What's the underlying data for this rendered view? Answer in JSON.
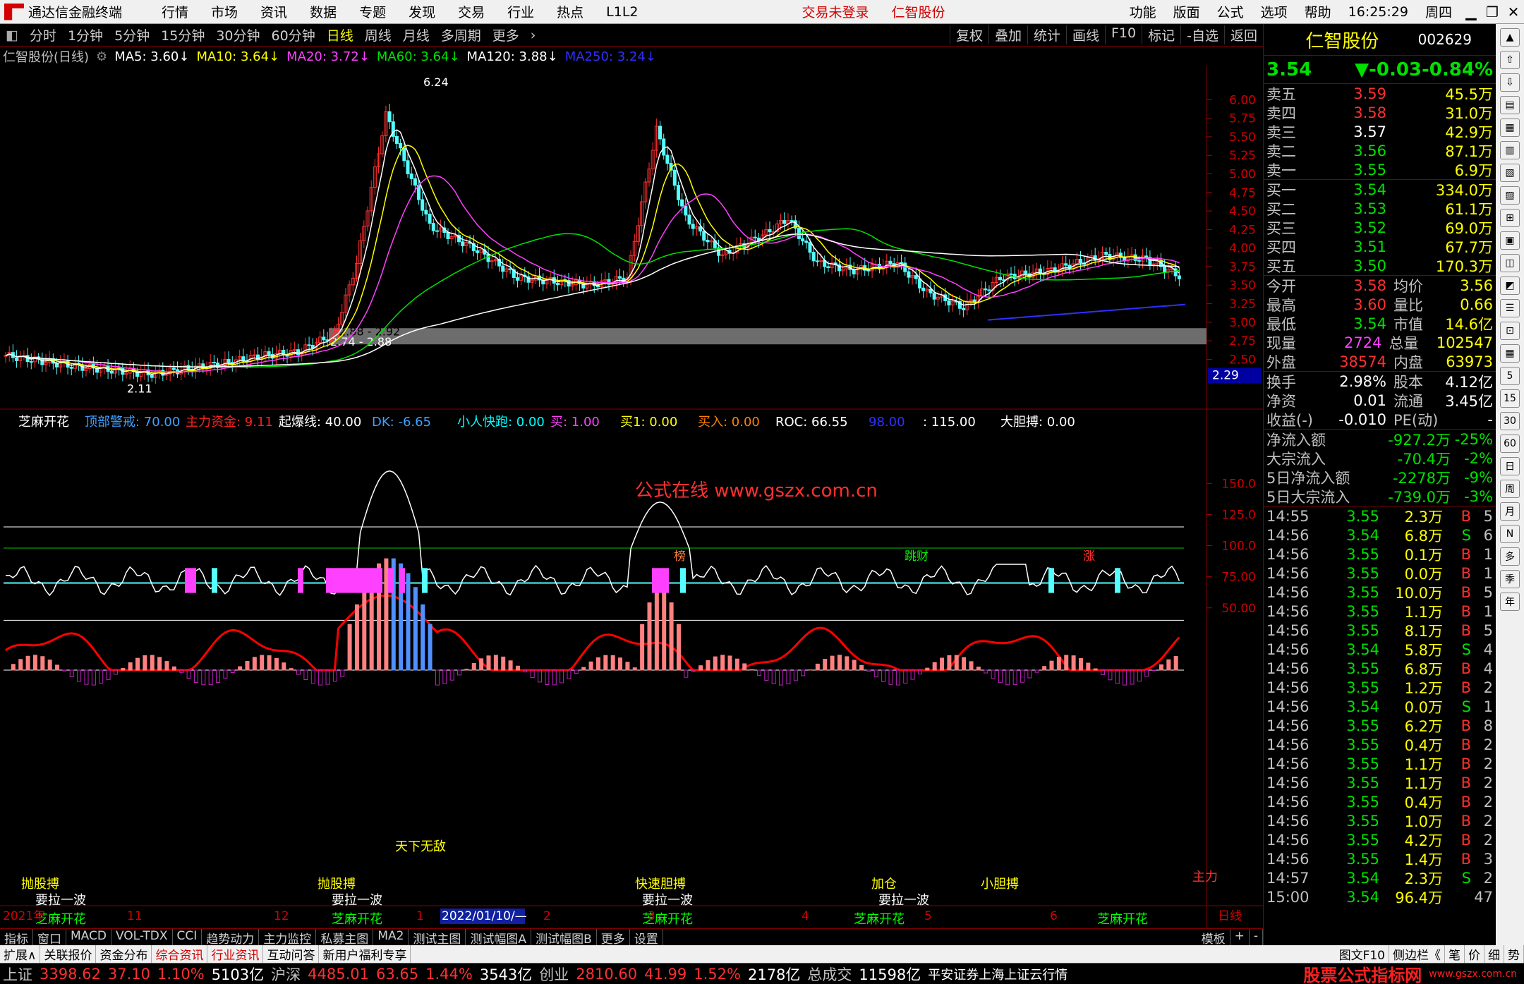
{
  "menu": {
    "app_title": "通达信金融终端",
    "items": [
      "行情",
      "市场",
      "资讯",
      "数据",
      "专题",
      "发现",
      "交易",
      "行业",
      "热点",
      "L1L2"
    ],
    "status": [
      "交易未登录",
      "仁智股份"
    ],
    "right_items": [
      "功能",
      "版面",
      "公式",
      "选项",
      "帮助"
    ],
    "time": "16:25:29",
    "weekday": "周四"
  },
  "periods": {
    "items": [
      "分时",
      "1分钟",
      "5分钟",
      "15分钟",
      "30分钟",
      "60分钟",
      "日线",
      "周线",
      "月线",
      "多周期",
      "更多"
    ],
    "selected": "日线",
    "right": [
      "复权",
      "叠加",
      "统计",
      "画线",
      "F10",
      "标记",
      "-自选",
      "返回"
    ]
  },
  "ma": {
    "title": "仁智股份(日线)",
    "items": [
      {
        "label": "MA5: 3.60",
        "color": "#ffffff"
      },
      {
        "label": "MA10: 3.64",
        "color": "#ffff00"
      },
      {
        "label": "MA20: 3.72",
        "color": "#ff40ff"
      },
      {
        "label": "MA60: 3.64",
        "color": "#00e000"
      },
      {
        "label": "MA120: 3.88",
        "color": "#ffffff"
      },
      {
        "label": "MA250: 3.24",
        "color": "#3030ff"
      }
    ]
  },
  "price_axis": [
    "6.00",
    "5.75",
    "5.50",
    "5.25",
    "5.00",
    "4.75",
    "4.50",
    "4.25",
    "4.00",
    "3.75",
    "3.50",
    "3.25",
    "3.00",
    "2.75",
    "2.50"
  ],
  "price_current": "2.29",
  "price_labels": {
    "high": "6.24",
    "low": "2.11",
    "band1": "2.88 - 2.92",
    "band2": "2.74 - 2.88"
  },
  "watermark": "公式在线 www.gszx.com.cn",
  "event_marks": [
    {
      "text": "榜",
      "color": "#ff8040"
    },
    {
      "text": "跳财",
      "color": "#00ff00"
    },
    {
      "text": "涨",
      "color": "#ff3030"
    }
  ],
  "indicator": {
    "name": "芝麻开花",
    "params": [
      {
        "label": "顶部警戒: 70.00",
        "color": "#40a0ff"
      },
      {
        "label": "主力资金: 9.11",
        "color": "#ff2020"
      },
      {
        "label": "起爆线: 40.00",
        "color": "#ffffff"
      },
      {
        "label": "DK: -6.65",
        "color": "#40a0ff"
      },
      {
        "label": "小人快跑: 0.00",
        "color": "#00ffff"
      },
      {
        "label": "买: 1.00",
        "color": "#ff40ff"
      },
      {
        "label": "买1: 0.00",
        "color": "#ffff00"
      },
      {
        "label": "买入: 0.00",
        "color": "#ff8000"
      },
      {
        "label": "ROC: 66.55",
        "color": "#ffffff"
      },
      {
        "label": "98.00",
        "color": "#3030ff"
      },
      {
        "label": ": 115.00",
        "color": "#ffffff"
      },
      {
        "label": "大胆搏: 0.00",
        "color": "#ffffff"
      }
    ],
    "axis": [
      "150.0",
      "125.0",
      "100.0",
      "75.00",
      "50.00"
    ],
    "labels": [
      "抛股搏",
      "抛股搏",
      "快速胆搏",
      "小胆搏",
      "天下无敌",
      "加仓",
      "要拉一波",
      "要拉一波",
      "要拉一波",
      "要拉一波",
      "芝麻开花",
      "芝麻开花",
      "芝麻开花",
      "芝麻开花",
      "芝麻开花",
      "主力"
    ]
  },
  "date_axis": [
    "2021年",
    "11",
    "12",
    "1",
    "2022/01/10/—",
    "2",
    "3",
    "4",
    "5",
    "6",
    "日线"
  ],
  "bottom_tabs": [
    "指标",
    "窗口",
    "MACD",
    "VOL-TDX",
    "CCI",
    "趋势动力",
    "主力监控",
    "私募主图",
    "MA2",
    "测试主图",
    "测试幅图A",
    "测试幅图B",
    "更多",
    "设置",
    "模板",
    "+",
    "-"
  ],
  "link_bar": [
    "扩展∧",
    "关联报价",
    "资金分布",
    "综合资讯",
    "行业资讯",
    "互动问答",
    "新用户福利专享",
    "图文F10",
    "侧边栏《",
    "笔",
    "价",
    "细",
    "势"
  ],
  "quote": {
    "name": "仁智股份",
    "code": "002629",
    "price": "3.54",
    "change": "▼-0.03",
    "pct": "-0.84%",
    "sells": [
      {
        "l": "卖五",
        "p": "3.59",
        "v": "45.5万",
        "pc": "#ff3030"
      },
      {
        "l": "卖四",
        "p": "3.58",
        "v": "31.0万",
        "pc": "#ff3030"
      },
      {
        "l": "卖三",
        "p": "3.57",
        "v": "42.9万",
        "pc": "#ffffff"
      },
      {
        "l": "卖二",
        "p": "3.56",
        "v": "87.1万",
        "pc": "#00e000"
      },
      {
        "l": "卖一",
        "p": "3.55",
        "v": "6.9万",
        "pc": "#00e000"
      }
    ],
    "buys": [
      {
        "l": "买一",
        "p": "3.54",
        "v": "334.0万",
        "pc": "#00e000"
      },
      {
        "l": "买二",
        "p": "3.53",
        "v": "61.1万",
        "pc": "#00e000"
      },
      {
        "l": "买三",
        "p": "3.52",
        "v": "69.0万",
        "pc": "#00e000"
      },
      {
        "l": "买四",
        "p": "3.51",
        "v": "67.7万",
        "pc": "#00e000"
      },
      {
        "l": "买五",
        "p": "3.50",
        "v": "170.3万",
        "pc": "#00e000"
      }
    ],
    "stats": [
      [
        "今开",
        "3.58",
        "均价",
        "3.56"
      ],
      [
        "最高",
        "3.60",
        "量比",
        "0.66"
      ],
      [
        "最低",
        "3.54",
        "市值",
        "14.6亿"
      ],
      [
        "现量",
        "2724",
        "总量",
        "102547"
      ],
      [
        "外盘",
        "38574",
        "内盘",
        "63973"
      ]
    ],
    "stats2": [
      [
        "换手",
        "2.98%",
        "股本",
        "4.12亿"
      ],
      [
        "净资",
        "0.01",
        "流通",
        "3.45亿"
      ],
      [
        "收益(-)",
        "-0.010",
        "PE(动)",
        "-"
      ]
    ],
    "flows": [
      {
        "l": "净流入额",
        "v": "-927.2万",
        "p": "-25%"
      },
      {
        "l": "大宗流入",
        "v": "-70.4万",
        "p": "-2%"
      },
      {
        "l": "5日净流入额",
        "v": "-2278万",
        "p": "-9%"
      },
      {
        "l": "5日大宗流入",
        "v": "-739.0万",
        "p": "-3%"
      }
    ],
    "ticks": [
      [
        "14:55",
        "3.55",
        "2.3万",
        "B",
        "5"
      ],
      [
        "14:56",
        "3.54",
        "6.8万",
        "S",
        "6"
      ],
      [
        "14:56",
        "3.55",
        "0.1万",
        "B",
        "1"
      ],
      [
        "14:56",
        "3.55",
        "0.0万",
        "B",
        "1"
      ],
      [
        "14:56",
        "3.55",
        "10.0万",
        "B",
        "5"
      ],
      [
        "14:56",
        "3.55",
        "1.1万",
        "B",
        "1"
      ],
      [
        "14:56",
        "3.55",
        "8.1万",
        "B",
        "5"
      ],
      [
        "14:56",
        "3.54",
        "5.8万",
        "S",
        "4"
      ],
      [
        "14:56",
        "3.55",
        "6.8万",
        "B",
        "4"
      ],
      [
        "14:56",
        "3.55",
        "1.2万",
        "B",
        "2"
      ],
      [
        "14:56",
        "3.54",
        "0.0万",
        "S",
        "1"
      ],
      [
        "14:56",
        "3.55",
        "6.2万",
        "B",
        "8"
      ],
      [
        "14:56",
        "3.55",
        "0.4万",
        "B",
        "2"
      ],
      [
        "14:56",
        "3.55",
        "1.1万",
        "B",
        "2"
      ],
      [
        "14:56",
        "3.55",
        "1.1万",
        "B",
        "2"
      ],
      [
        "14:56",
        "3.55",
        "0.4万",
        "B",
        "2"
      ],
      [
        "14:56",
        "3.55",
        "1.0万",
        "B",
        "2"
      ],
      [
        "14:56",
        "3.55",
        "4.2万",
        "B",
        "2"
      ],
      [
        "14:56",
        "3.55",
        "1.4万",
        "B",
        "3"
      ],
      [
        "14:57",
        "3.54",
        "2.3万",
        "S",
        "2"
      ],
      [
        "15:00",
        "3.54",
        "96.4万",
        "",
        "47"
      ]
    ]
  },
  "side_tools": [
    "日",
    "周",
    "月",
    "N",
    "多",
    "季",
    "年"
  ],
  "side_tools2": [
    "5",
    "15",
    "30",
    "60"
  ],
  "status": {
    "items": [
      {
        "n": "上证",
        "v": "3398.62",
        "c": "37.10",
        "p": "1.10%",
        "a": "5103亿"
      },
      {
        "n": "沪深",
        "v": "4485.01",
        "c": "63.65",
        "p": "1.44%",
        "a": "3543亿"
      },
      {
        "n": "创业",
        "v": "2810.60",
        "c": "41.99",
        "p": "1.52%",
        "a": "2178亿"
      }
    ],
    "total_label": "总成交",
    "total": "11598亿",
    "feed": "平安证券上海上证云行情",
    "brand": "股票公式指标网",
    "brand_url": "www.gszx.com.cn"
  }
}
